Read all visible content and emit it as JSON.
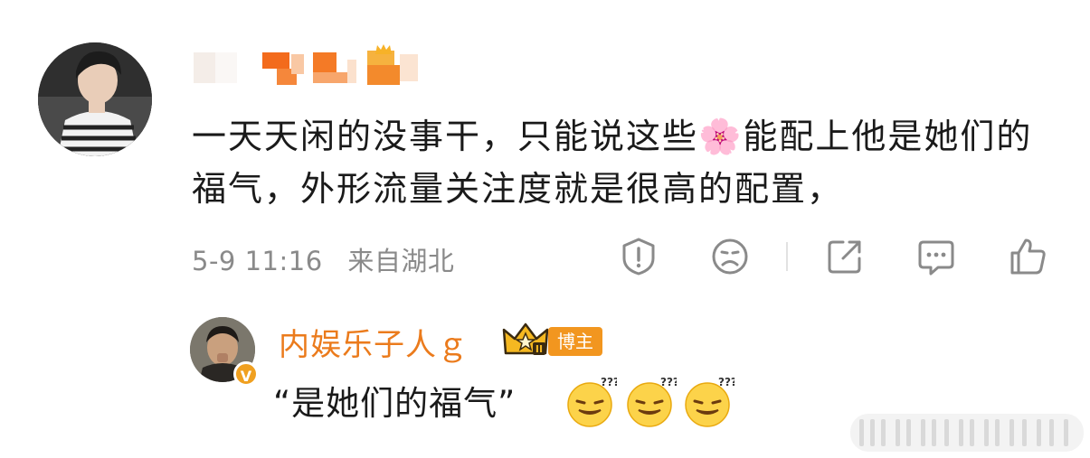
{
  "comment": {
    "text": "一天天闲的没事干，只能说这些🌸能配上他是她们的福气，外形流量关注度就是很高的配置，",
    "time": "5-9 11:16",
    "location": "来自湖北"
  },
  "actions": [
    {
      "name": "report-icon"
    },
    {
      "name": "dislike-icon"
    },
    {
      "name": "share-icon"
    },
    {
      "name": "comment-icon"
    },
    {
      "name": "like-icon"
    }
  ],
  "reply": {
    "username": "内娱乐子人ｇ",
    "badge_label": "博主",
    "text": "“是她们的福气”"
  },
  "colors": {
    "username": "#eb7b1c",
    "badge": "#f2961f",
    "text": "#1a1a1a",
    "meta": "#8a8a8a"
  }
}
